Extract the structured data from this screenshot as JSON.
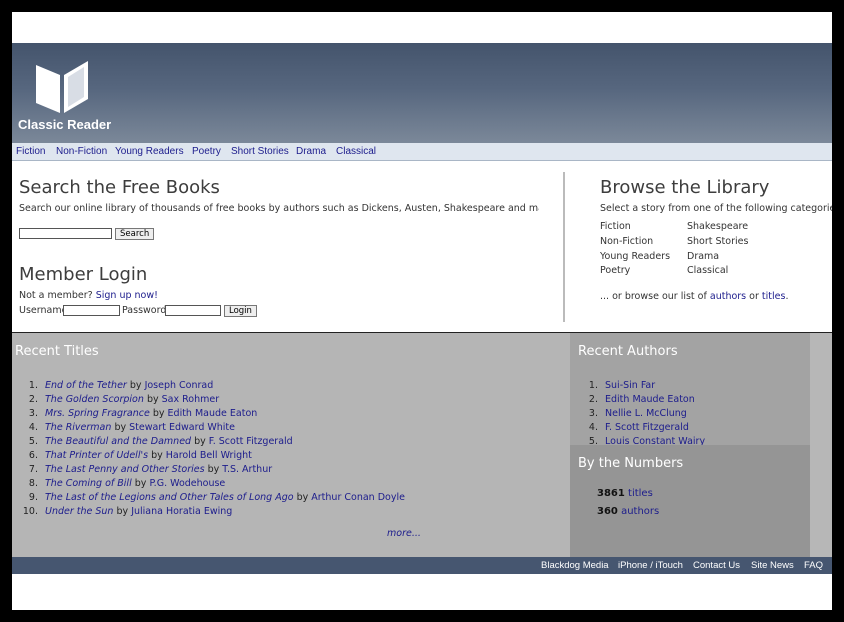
{
  "site": {
    "name": "Classic Reader",
    "logo_icon": "open-book-icon"
  },
  "nav": [
    "Fiction",
    "Non-Fiction",
    "Young Readers",
    "Poetry",
    "Short Stories",
    "Drama",
    "Classical"
  ],
  "search": {
    "title": "Search the Free Books",
    "description": "Search our online library of thousands of free books by authors such as Dickens, Austen, Shakespeare and many o",
    "input_value": "",
    "button": "Search"
  },
  "login": {
    "title": "Member Login",
    "prompt": "Not a member?",
    "signup_link": "Sign up now!",
    "username_label": "Username",
    "password_label": "Password",
    "button": "Login"
  },
  "browse": {
    "title": "Browse the Library",
    "description": "Select a story from one of the following categories",
    "categories_left": [
      "Fiction",
      "Non-Fiction",
      "Young Readers",
      "Poetry"
    ],
    "categories_right": [
      "Shakespeare",
      "Short Stories",
      "Drama",
      "Classical"
    ],
    "or_text": "... or browse our list of",
    "authors_link": "authors",
    "or_word": "or",
    "titles_link": "titles",
    "period": "."
  },
  "recent_titles": {
    "heading": "Recent Titles",
    "items": [
      {
        "num": "1.",
        "title": "End of the Tether",
        "by": "by",
        "author": "Joseph Conrad"
      },
      {
        "num": "2.",
        "title": "The Golden Scorpion",
        "by": "by",
        "author": "Sax Rohmer"
      },
      {
        "num": "3.",
        "title": "Mrs. Spring Fragrance",
        "by": "by",
        "author": "Edith Maude Eaton"
      },
      {
        "num": "4.",
        "title": "The Riverman",
        "by": "by",
        "author": "Stewart Edward White"
      },
      {
        "num": "5.",
        "title": "The Beautiful and the Damned",
        "by": "by",
        "author": "F. Scott Fitzgerald"
      },
      {
        "num": "6.",
        "title": "That Printer of Udell's",
        "by": "by",
        "author": "Harold Bell Wright"
      },
      {
        "num": "7.",
        "title": "The Last Penny and Other Stories",
        "by": "by",
        "author": "T.S. Arthur"
      },
      {
        "num": "8.",
        "title": "The Coming of Bill",
        "by": "by",
        "author": "P.G. Wodehouse"
      },
      {
        "num": "9.",
        "title": "The Last of the Legions and Other Tales of Long Ago",
        "by": "by",
        "author": "Arthur Conan Doyle"
      },
      {
        "num": "10.",
        "title": "Under the Sun",
        "by": "by",
        "author": "Juliana Horatia Ewing"
      }
    ],
    "more": "more..."
  },
  "recent_authors": {
    "heading": "Recent Authors",
    "items": [
      {
        "num": "1.",
        "name": "Sui-Sin Far"
      },
      {
        "num": "2.",
        "name": "Edith Maude Eaton"
      },
      {
        "num": "3.",
        "name": "Nellie L. McClung"
      },
      {
        "num": "4.",
        "name": "F. Scott Fitzgerald"
      },
      {
        "num": "5.",
        "name": "Louis Constant Wairy"
      }
    ]
  },
  "numbers": {
    "heading": "By the Numbers",
    "titles_count": "3861",
    "titles_label": "titles",
    "authors_count": "360",
    "authors_label": "authors"
  },
  "footer": [
    "Blackdog Media",
    "iPhone / iTouch",
    "Contact Us",
    "Site News",
    "FAQ"
  ]
}
